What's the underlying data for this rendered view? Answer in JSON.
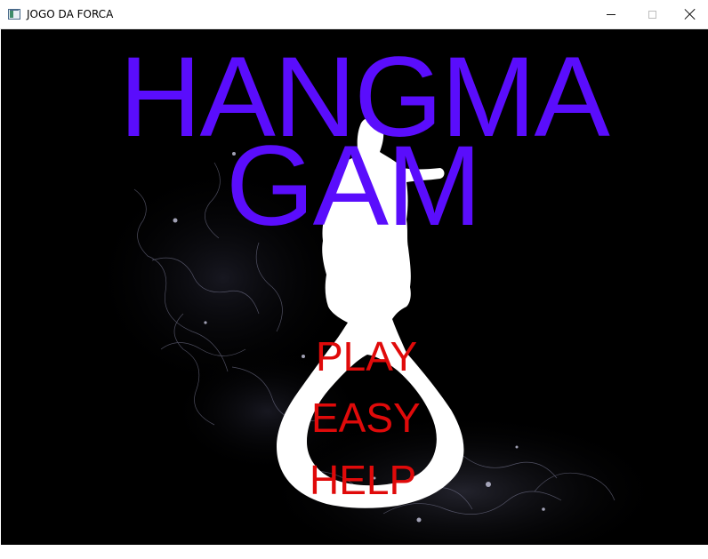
{
  "window": {
    "title": "JOGO DA FORCA",
    "icon": "app-window-icon",
    "controls": {
      "minimize_icon": "minimize-icon",
      "maximize_icon": "maximize-icon",
      "close_icon": "close-icon"
    }
  },
  "game": {
    "title_line_1": "HANGMA",
    "title_line_2": "GAM",
    "title_color": "#5a0dfc",
    "menu": {
      "play": "PLAY",
      "easy": "EASY",
      "help": "HELP"
    },
    "menu_color": "#e00a0a",
    "background_color": "#000000",
    "noose_color": "#ffffff"
  }
}
